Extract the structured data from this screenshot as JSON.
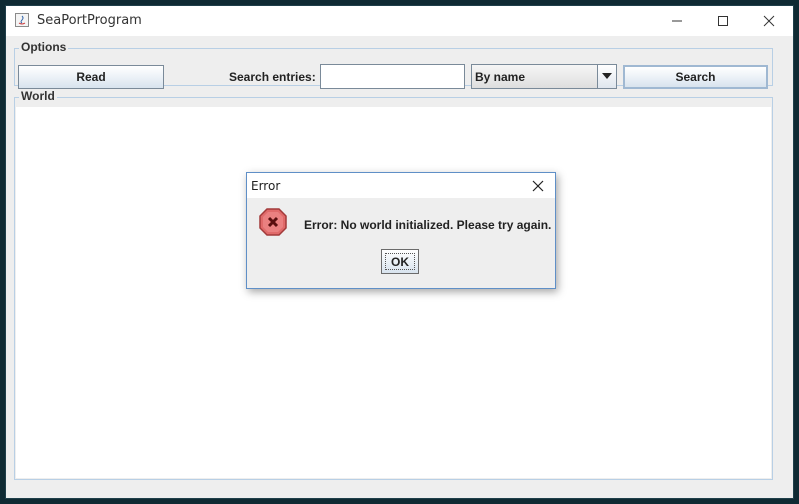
{
  "window": {
    "title": "SeaPortProgram",
    "icons": {
      "app": "java-icon",
      "minimize": "minimize-icon",
      "maximize": "maximize-icon",
      "close": "close-icon"
    }
  },
  "options": {
    "group_title": "Options",
    "read_label": "Read",
    "search_label": "Search entries:",
    "search_value": "",
    "search_by_selected": "By name",
    "search_button_label": "Search"
  },
  "world": {
    "group_title": "World"
  },
  "dialog": {
    "title": "Error",
    "message": "Error: No world initialized. Please try again.",
    "ok_label": "OK",
    "icon": "error-icon",
    "colors": {
      "error_fill": "#e06a6a",
      "error_border": "#a23a3a",
      "dialog_border": "#5f8fc7"
    }
  }
}
